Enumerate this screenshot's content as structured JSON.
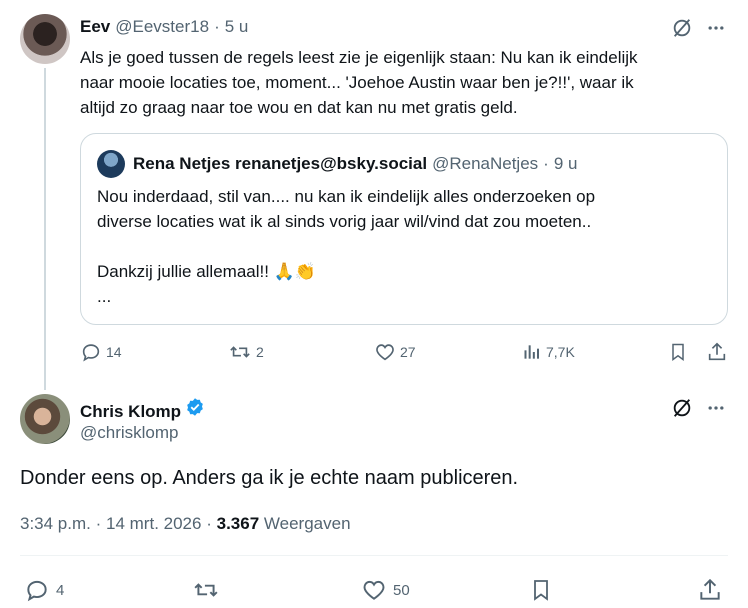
{
  "tweet1": {
    "name": "Eev",
    "handle": "@Eevster18",
    "separator": "·",
    "time": "5 u",
    "text": "Als je goed tussen de regels leest zie je eigenlijk staan: Nu kan ik eindelijk\nnaar mooie locaties toe, moment... 'Joehoe Austin waar ben je?!!', waar ik\naltijd zo graag naar toe wou en dat kan nu met gratis geld.",
    "quote": {
      "name": "Rena Netjes renanetjes@bsky.social",
      "handle": "@RenaNetjes",
      "separator": "·",
      "time": "9 u",
      "text": "Nou inderdaad, stil van.... nu kan ik eindelijk alles onderzoeken op\ndiverse locaties  wat ik al sinds vorig jaar wil/vind dat zou moeten..\n\nDankzij jullie allemaal!! 🙏👏\n..."
    },
    "actions": {
      "replies": "14",
      "reposts": "2",
      "likes": "27",
      "views": "7,7K"
    }
  },
  "tweet2": {
    "name": "Chris Klomp",
    "handle": "@chrisklomp",
    "text": "Donder eens op. Anders ga ik je echte naam publiceren.",
    "time": "3:34 p.m.",
    "separator1": "·",
    "date": "14 mrt. 2026",
    "separator2": "·",
    "views_count": "3.367",
    "views_label": "Weergaven",
    "actions": {
      "replies": "4",
      "likes": "50"
    }
  },
  "colors": {
    "text": "#0f1419",
    "secondary": "#536471",
    "border": "#cfd9de",
    "verified": "#1d9bf0"
  }
}
